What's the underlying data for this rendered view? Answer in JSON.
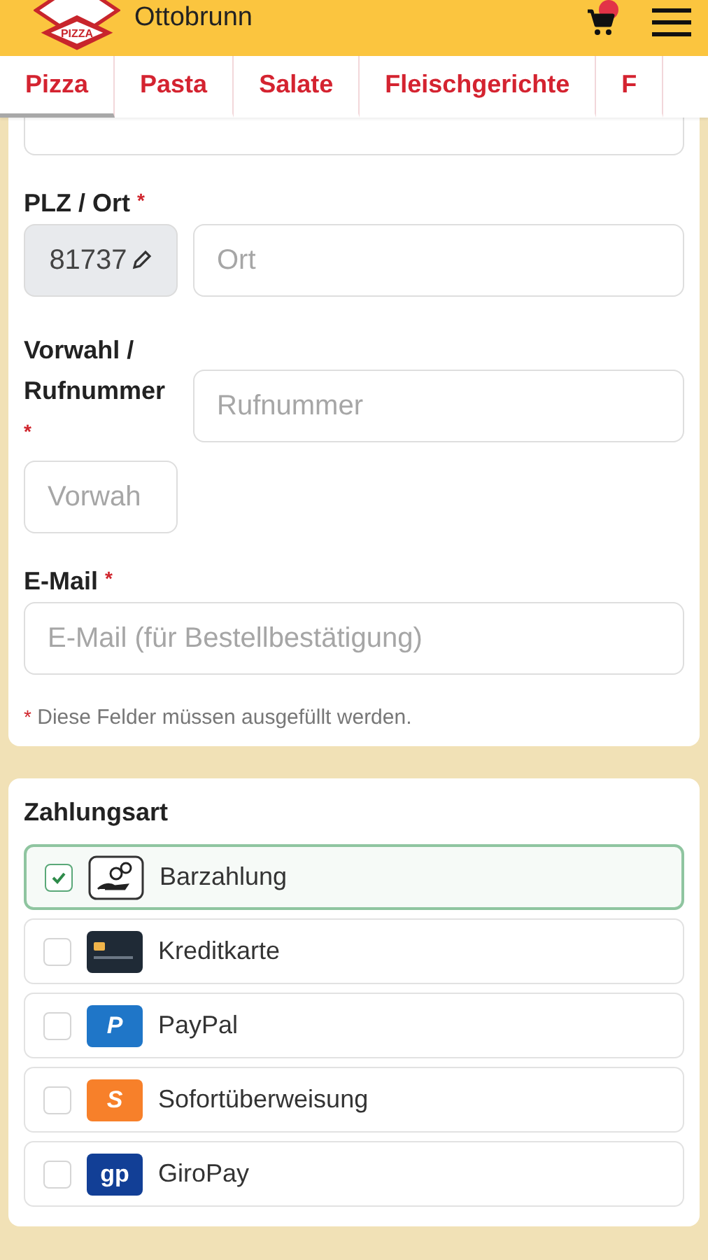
{
  "header": {
    "logo_text": "PIZZA",
    "city": "Ottobrunn",
    "cart_badge": true
  },
  "tabs": [
    {
      "label": "Pizza",
      "selected": true
    },
    {
      "label": "Pasta",
      "selected": false
    },
    {
      "label": "Salate",
      "selected": false
    },
    {
      "label": "Fleischgerichte",
      "selected": false
    },
    {
      "label": "F",
      "selected": false
    }
  ],
  "address": {
    "plz_label": "PLZ / Ort",
    "required_mark": "*",
    "plz_value": "81737",
    "ort_placeholder": "Ort",
    "phone_label": "Vorwahl / Rufnummer",
    "rufnummer_placeholder": "Rufnummer",
    "vorwahl_placeholder": "Vorwah",
    "email_label": "E-Mail",
    "email_placeholder": "E-Mail (für Bestellbestätigung)",
    "note_mark": "*",
    "note": "Diese Felder müssen ausgefüllt werden."
  },
  "payment": {
    "title": "Zahlungsart",
    "methods": [
      {
        "kind": "cash",
        "label": "Barzahlung",
        "selected": true
      },
      {
        "kind": "card",
        "label": "Kreditkarte",
        "selected": false
      },
      {
        "kind": "paypal",
        "label": "PayPal",
        "icon_text": "P",
        "selected": false
      },
      {
        "kind": "sofort",
        "label": "Sofortüberweisung",
        "icon_text": "S",
        "selected": false
      },
      {
        "kind": "giropay",
        "label": "GiroPay",
        "icon_text": "gp",
        "selected": false
      }
    ]
  }
}
